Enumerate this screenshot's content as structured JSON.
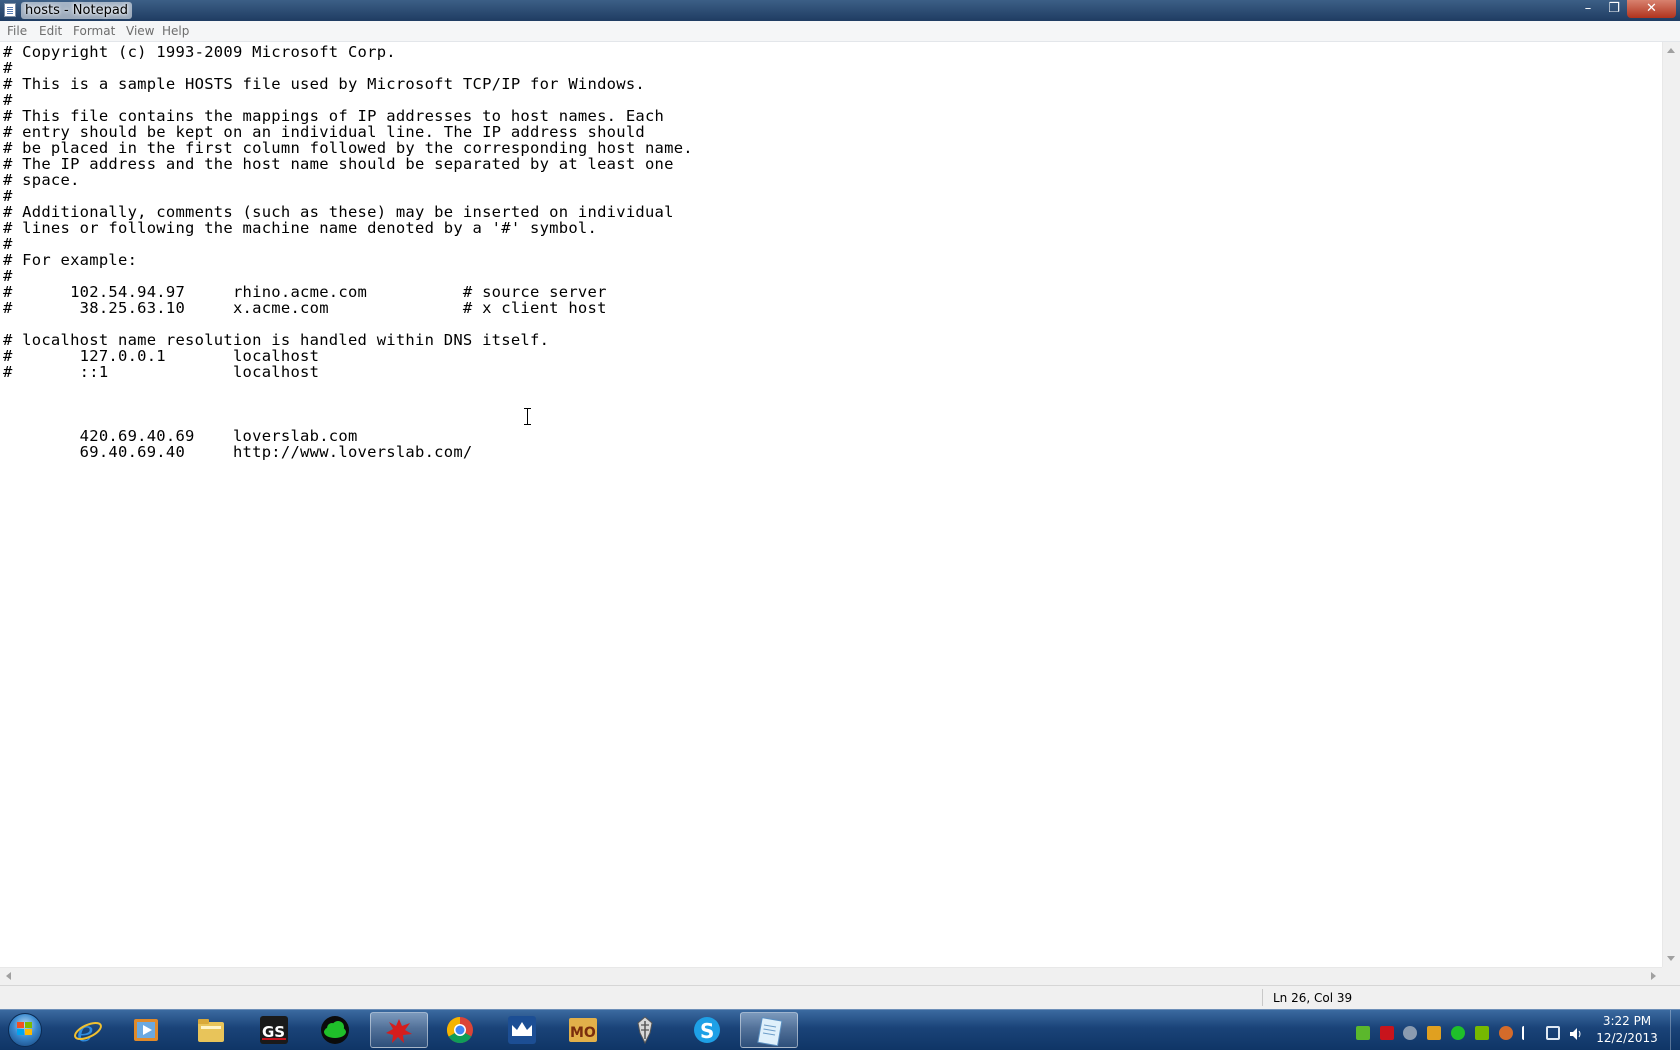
{
  "window": {
    "title": "hosts - Notepad",
    "min_glyph": "–",
    "max_glyph": "❐",
    "close_glyph": "✕"
  },
  "menu": [
    "File",
    "Edit",
    "Format",
    "View",
    "Help"
  ],
  "editor": {
    "lines": [
      "# Copyright (c) 1993-2009 Microsoft Corp.",
      "#",
      "# This is a sample HOSTS file used by Microsoft TCP/IP for Windows.",
      "#",
      "# This file contains the mappings of IP addresses to host names. Each",
      "# entry should be kept on an individual line. The IP address should",
      "# be placed in the first column followed by the corresponding host name.",
      "# The IP address and the host name should be separated by at least one",
      "# space.",
      "#",
      "# Additionally, comments (such as these) may be inserted on individual",
      "# lines or following the machine name denoted by a '#' symbol.",
      "#",
      "# For example:",
      "#",
      "#      102.54.94.97     rhino.acme.com          # source server",
      "#       38.25.63.10     x.acme.com              # x client host",
      "",
      "# localhost name resolution is handled within DNS itself.",
      "#       127.0.0.1       localhost",
      "#       ::1             localhost",
      "",
      "",
      "",
      "        420.69.40.69    loverslab.com",
      "        69.40.69.40     http://www.loverslab.com/"
    ]
  },
  "statusbar": {
    "position": "Ln 26, Col 39"
  },
  "taskbar": {
    "apps": [
      {
        "name": "internet-explorer",
        "color": "#2f8ce0"
      },
      {
        "name": "media-player",
        "color": "#e08a2a"
      },
      {
        "name": "file-explorer",
        "color": "#e8c45a"
      },
      {
        "name": "gs-app",
        "label": "GS",
        "color": "#c8141c"
      },
      {
        "name": "green-cloud-app",
        "color": "#1fbf2a"
      },
      {
        "name": "red-splat-app",
        "color": "#d51d1d"
      },
      {
        "name": "chrome",
        "color": "#e8b51c"
      },
      {
        "name": "crown-app",
        "color": "#f0f0f0"
      },
      {
        "name": "mo-app",
        "label": "MO",
        "color": "#c46a1a"
      },
      {
        "name": "skyrim",
        "color": "#d8d8d8"
      },
      {
        "name": "skype",
        "label": "S",
        "color": "#1ea0e6"
      },
      {
        "name": "notepad",
        "color": "#9ecbe8"
      }
    ],
    "clock": {
      "time": "3:22 PM",
      "date": "12/2/2013"
    }
  }
}
